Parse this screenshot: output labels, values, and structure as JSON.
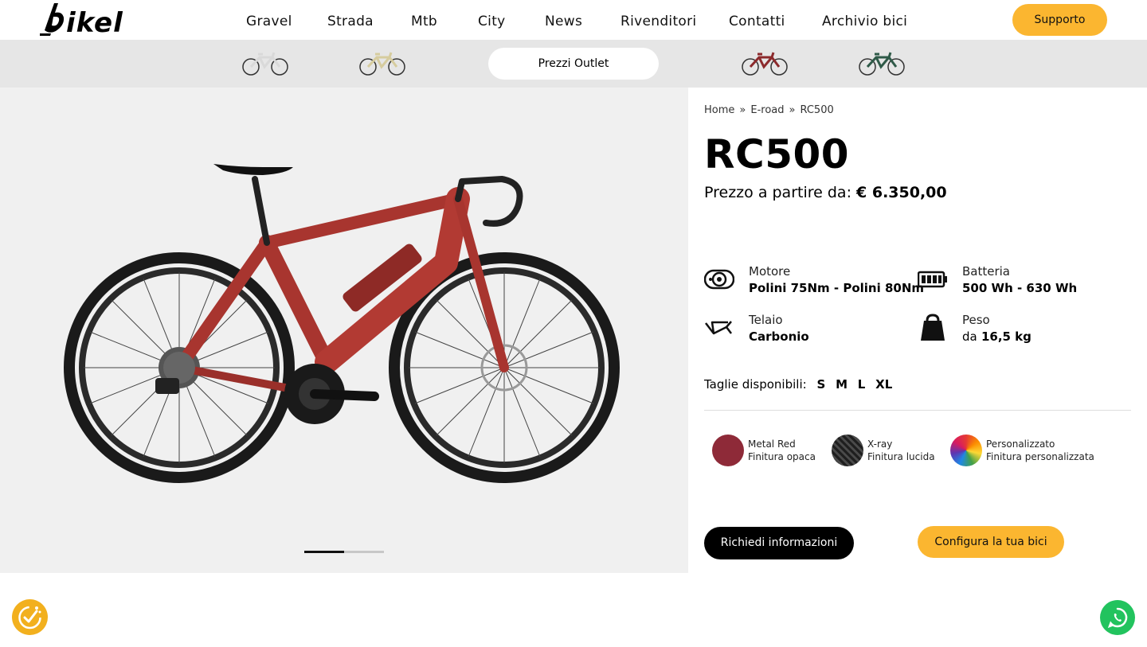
{
  "brand": {
    "logo_text": "bikel",
    "accent": "#fbb630",
    "dark": "#000000"
  },
  "nav": {
    "items": [
      "Gravel",
      "Strada",
      "Mtb",
      "City",
      "News",
      "Rivenditori",
      "Contatti",
      "Archivio bici"
    ],
    "support_label": "Supporto"
  },
  "subnav": {
    "outlet_label": "Prezzi Outlet",
    "thumbnails": [
      {
        "icon": "white-bike-icon",
        "color": "#e9e9e9"
      },
      {
        "icon": "beige-bike-icon",
        "color": "#d8cfa8"
      },
      {
        "icon": "red-bike-icon",
        "color": "#8c2a2c"
      },
      {
        "icon": "green-bike-icon",
        "color": "#2f5a48"
      }
    ]
  },
  "gallery": {
    "image": "red-road-ebike-image",
    "slide_progress": 0.5
  },
  "product": {
    "breadcrumb": [
      "Home",
      "E-road",
      "RC500"
    ],
    "breadcrumb_separator": "»",
    "title": "RC500",
    "price_label": "Prezzo a partire da:",
    "price_value": "€ 6.350,00",
    "specs": [
      {
        "icon": "motor-icon",
        "label": "Motore",
        "value": "Polini 75Nm - Polini 80Nm",
        "prefix": ""
      },
      {
        "icon": "battery-icon",
        "label": "Batteria",
        "value": "500 Wh - 630 Wh",
        "prefix": ""
      },
      {
        "icon": "frame-icon",
        "label": "Telaio",
        "value": "Carbonio",
        "prefix": ""
      },
      {
        "icon": "weight-icon",
        "label": "Peso",
        "value": "16,5 kg",
        "prefix": "da"
      }
    ],
    "sizes_label": "Taglie disponibili:",
    "sizes": [
      "S",
      "M",
      "L",
      "XL"
    ],
    "colours": [
      {
        "name": "Metal Red",
        "finish": "Finitura opaca",
        "color": "#8e2a38"
      },
      {
        "name": "X-ray",
        "finish": "Finitura lucida",
        "color": "#2b2b2b"
      },
      {
        "name": "Personalizzato",
        "finish": "Finitura personalizzata",
        "color": "multicolor"
      }
    ],
    "cta_info": "Richiedi informazioni",
    "cta_config": "Configura la tua bici"
  },
  "floating": {
    "cookie_icon": "cookie-consent-icon",
    "chat_icon": "whatsapp-icon"
  }
}
